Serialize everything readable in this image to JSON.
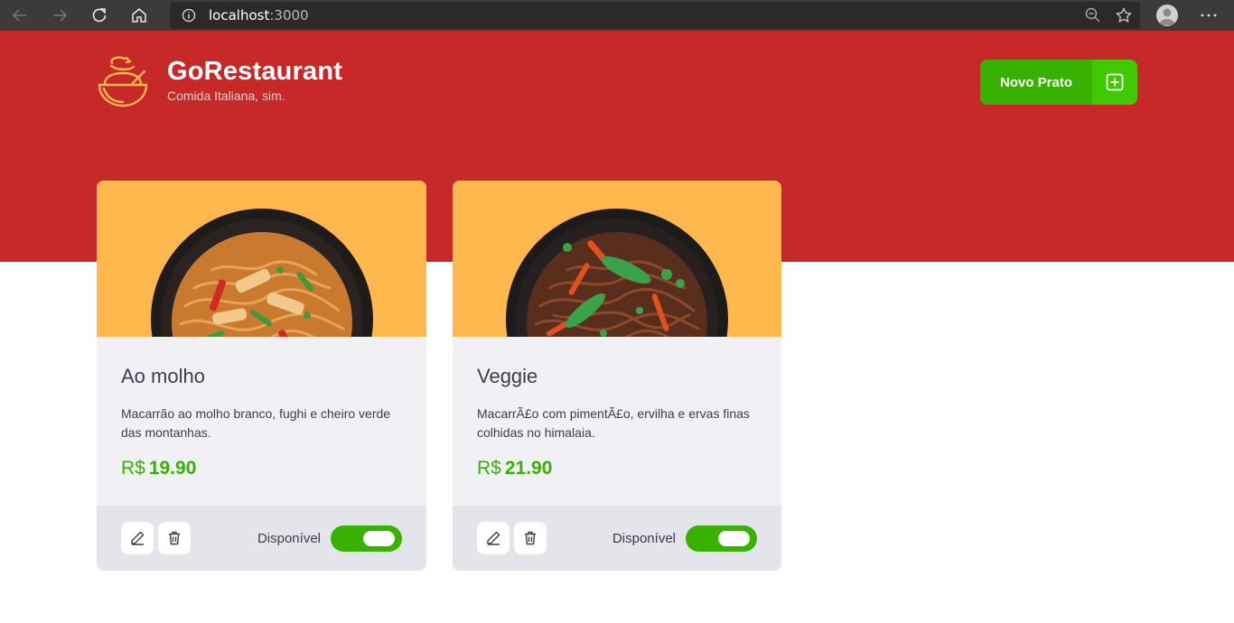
{
  "browser": {
    "url_host": "localhost",
    "url_port": ":3000"
  },
  "header": {
    "title": "GoRestaurant",
    "subtitle": "Comida Italiana, sim.",
    "new_button_label": "Novo Prato"
  },
  "foods": [
    {
      "name": "Ao molho",
      "description": "Macarrão ao molho branco, fughi e cheiro verde das montanhas.",
      "currency": "R$",
      "price": "19.90",
      "available_label": "Disponível",
      "available": true
    },
    {
      "name": "Veggie",
      "description": "MacarrÃ£o com pimentÃ£o, ervilha e ervas finas colhidas no himalaia.",
      "currency": "R$",
      "price": "21.90",
      "available_label": "Disponível",
      "available": true
    }
  ],
  "colors": {
    "header_bg": "#c72828",
    "accent_green": "#39b100",
    "card_image_bg": "#ffb84d",
    "card_bg": "#f0f0f5",
    "card_footer_bg": "#e4e4eb"
  },
  "icons": {
    "back": "arrow-left-icon",
    "forward": "arrow-right-icon",
    "reload": "reload-icon",
    "home": "home-icon",
    "site_info": "info-icon",
    "zoom": "zoom-icon",
    "favorite": "star-icon",
    "menu": "more-icon",
    "logo": "bowl-icon",
    "add": "plus-square-icon",
    "edit": "pencil-icon",
    "delete": "trash-icon"
  }
}
